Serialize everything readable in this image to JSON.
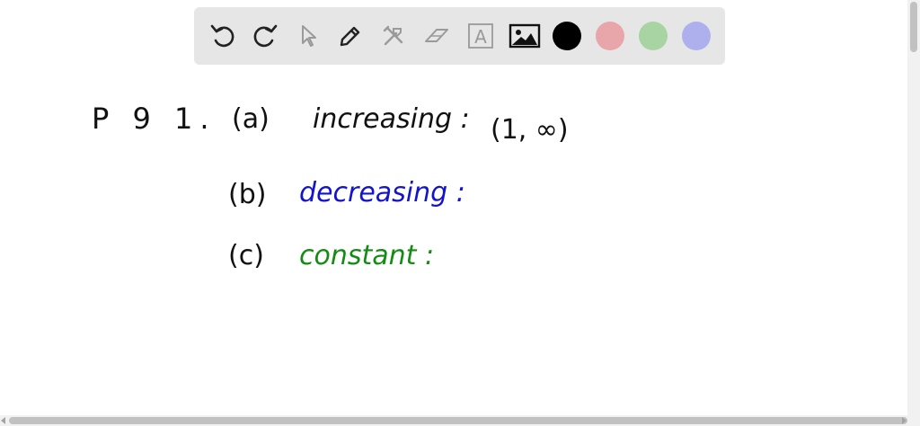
{
  "toolbar": {
    "tools": [
      {
        "icon": "undo-icon"
      },
      {
        "icon": "redo-icon"
      },
      {
        "icon": "pointer-icon"
      },
      {
        "icon": "pen-icon"
      },
      {
        "icon": "tools-icon"
      },
      {
        "icon": "eraser-icon"
      },
      {
        "icon": "text-icon",
        "glyph": "A"
      },
      {
        "icon": "image-icon"
      }
    ],
    "colors": {
      "black": "#000000",
      "red": "#e8a5aa",
      "green": "#a8d4a4",
      "blue": "#aeb0ee"
    }
  },
  "notes": {
    "problem": "P 9 1.",
    "part_a_label": "(a)",
    "part_a_text": "increasing :",
    "part_a_answer": "(1, ∞)",
    "part_b_label": "(b)",
    "part_b_text": "decreasing :",
    "part_c_label": "(c)",
    "part_c_text": "constant :",
    "ink_colors": {
      "black": "#111111",
      "blue": "#1414cc",
      "green": "#148c14"
    }
  }
}
